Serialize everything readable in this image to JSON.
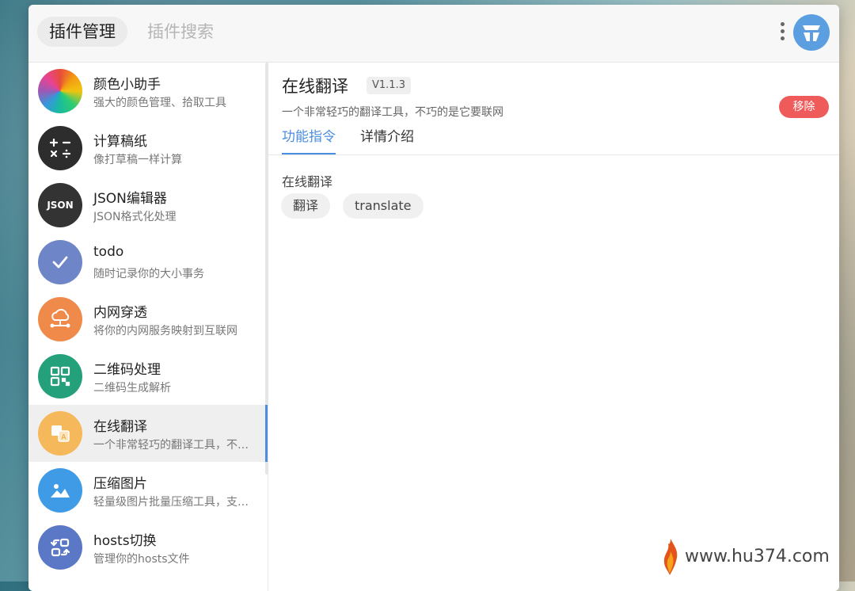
{
  "header": {
    "tab_active": "插件管理",
    "tab_search": "插件搜索"
  },
  "sidebar": {
    "items": [
      {
        "name": "颜色小助手",
        "desc": "强大的颜色管理、拾取工具",
        "icon": "color-wheel-icon",
        "color": "#e74c3c"
      },
      {
        "name": "计算稿纸",
        "desc": "像打草稿一样计算",
        "icon": "calculator-icon",
        "color": "#2d2d2d"
      },
      {
        "name": "JSON编辑器",
        "desc": "JSON格式化处理",
        "icon": "json-icon",
        "icon_text": "JSON",
        "color": "#333333"
      },
      {
        "name": "todo",
        "desc": "随时记录你的大小事务",
        "icon": "check-icon",
        "color": "#6e86c8"
      },
      {
        "name": "内网穿透",
        "desc": "将你的内网服务映射到互联网",
        "icon": "cloud-network-icon",
        "color": "#f08a4b"
      },
      {
        "name": "二维码处理",
        "desc": "二维码生成解析",
        "icon": "qrcode-icon",
        "color": "#24a07a"
      },
      {
        "name": "在线翻译",
        "desc": "一个非常轻巧的翻译工具，不巧的是它要联网",
        "icon": "translate-icon",
        "color": "#f5b85a",
        "active": true
      },
      {
        "name": "压缩图片",
        "desc": "轻量级图片批量压缩工具，支持多种格式",
        "icon": "image-icon",
        "color": "#3f9be6"
      },
      {
        "name": "hosts切换",
        "desc": "管理你的hosts文件",
        "icon": "switch-icon",
        "color": "#5b78c6"
      }
    ]
  },
  "detail": {
    "title": "在线翻译",
    "version": "V1.1.3",
    "description": "一个非常轻巧的翻译工具，不巧的是它要联网",
    "remove_label": "移除",
    "tabs": [
      "功能指令",
      "详情介绍"
    ],
    "section_title": "在线翻译",
    "commands": [
      "翻译",
      "translate"
    ]
  },
  "watermark": {
    "text": "www.hu374.com"
  }
}
